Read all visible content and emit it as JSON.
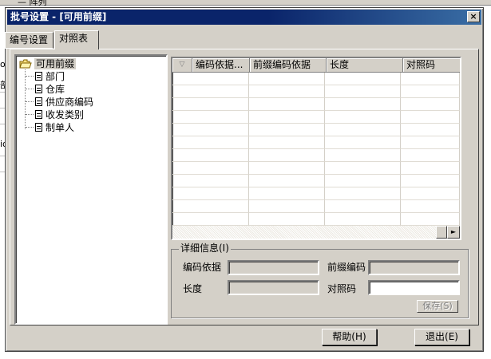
{
  "background": {
    "top_text": "—  阵列",
    "side_texts": [
      "or",
      "部",
      "io"
    ]
  },
  "dialog": {
    "title": "批号设置 - [可用前缀]",
    "close_label": "×"
  },
  "tabs": [
    {
      "label": "编号设置"
    },
    {
      "label": "对照表"
    }
  ],
  "tree": {
    "root_label": "可用前缀",
    "items": [
      {
        "label": "部门"
      },
      {
        "label": "仓库"
      },
      {
        "label": "供应商编码"
      },
      {
        "label": "收发类别"
      },
      {
        "label": "制单人"
      }
    ]
  },
  "grid": {
    "indicator": "▽",
    "columns": [
      {
        "label": "编码依据..."
      },
      {
        "label": "前缀编码依据"
      },
      {
        "label": "长度"
      },
      {
        "label": "对照码"
      }
    ],
    "scroll_right_arrow": "►"
  },
  "detail": {
    "legend": "详细信息(I)",
    "code_basis_label": "编码依据",
    "code_basis_value": "",
    "prefix_code_label": "前缀编码",
    "prefix_code_value": "",
    "length_label": "长度",
    "length_value": "",
    "ref_code_label": "对照码",
    "ref_code_value": "",
    "save_label": "保存(S)"
  },
  "buttons": {
    "help": "帮助(H)",
    "exit": "退出(E)"
  }
}
